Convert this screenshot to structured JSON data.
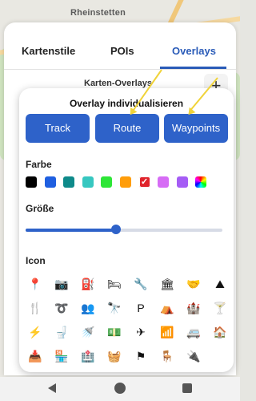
{
  "map": {
    "place_label": "Rheinstetten"
  },
  "tabs": [
    {
      "label": "Kartenstile",
      "active": false
    },
    {
      "label": "POIs",
      "active": false
    },
    {
      "label": "Overlays",
      "active": true
    }
  ],
  "overlays": {
    "title": "Karten-Overlays",
    "add_label": "+"
  },
  "dialog": {
    "title": "Overlay individualisieren",
    "buttons": [
      "Track",
      "Route",
      "Waypoints"
    ],
    "color_label": "Farbe",
    "colors": [
      "#000000",
      "#1f5fe0",
      "#0e8a8a",
      "#37c7c0",
      "#2ee637",
      "#ff9d0a",
      "#e0242c",
      "#d66cf5",
      "#a55cf5",
      "rainbow"
    ],
    "selected_color_index": 6,
    "size_label": "Größe",
    "size_value_percent": 46,
    "icon_label": "Icon",
    "icons": [
      [
        "map-pin-icon",
        "camera-icon",
        "fuel-pump-icon",
        "bed-icon",
        "wrench-icon",
        "bank-icon",
        "handshake-icon",
        "mountain-icon"
      ],
      [
        "restaurant-icon",
        "route-icon",
        "group-icon",
        "binoculars-icon",
        "parking-icon",
        "tent-icon",
        "castle-icon",
        "cocktail-icon"
      ],
      [
        "charging-icon",
        "toilet-icon",
        "shower-icon",
        "money-icon",
        "airplane-icon",
        "wifi-icon",
        "camper-icon",
        "garage-icon"
      ],
      [
        "inbox-icon",
        "shop-icon",
        "hospital-icon",
        "washing-machine-icon",
        "flag-icon",
        "picnic-icon",
        "ev-station-icon"
      ]
    ],
    "icon_glyphs": [
      [
        "📍",
        "📷",
        "⛽",
        "🛏",
        "🔧",
        "🏛",
        "🤝",
        "⛰"
      ],
      [
        "🍴",
        "➰",
        "👥",
        "🔭",
        "P",
        "⛺",
        "🏰",
        "🍸"
      ],
      [
        "⚡",
        "🚽",
        "🚿",
        "💵",
        "✈",
        "📶",
        "🚐",
        "🏠"
      ],
      [
        "📥",
        "🏪",
        "🏥",
        "🧺",
        "⚑",
        "🪑",
        "🔌"
      ]
    ]
  }
}
